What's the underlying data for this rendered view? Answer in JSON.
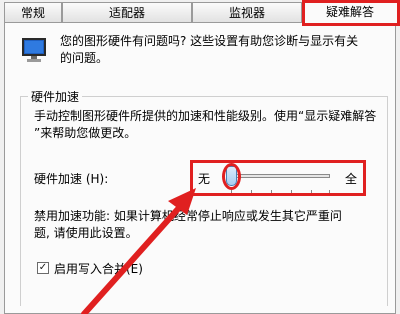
{
  "tabs": [
    {
      "label": "常规"
    },
    {
      "label": "适配器"
    },
    {
      "label": "监视器"
    },
    {
      "label": "疑难解答",
      "active": true
    }
  ],
  "intro": {
    "icon": "monitor-icon",
    "line1": "您的图形硬件有问题吗? 这些设置有助您诊断与显示有关",
    "line2": "的问题。"
  },
  "group": {
    "title": "硬件加速",
    "desc_line1": "手动控制图形硬件所提供的加速和性能级别。使用“显示疑难解答",
    "desc_line2": "”来帮助您做更改。"
  },
  "slider": {
    "label": "硬件加速 (H):",
    "min_label": "无",
    "max_label": "全",
    "value": 0,
    "steps": 6
  },
  "disable_note": {
    "line1": "禁用加速功能: 如果计算机经常停止响应或发生其它严重问",
    "line2": "题, 请使用此设置。"
  },
  "checkbox": {
    "label": "启用写入合并(E)",
    "checked": true,
    "mark": "✓"
  },
  "annotation": {
    "color": "#e02020"
  }
}
